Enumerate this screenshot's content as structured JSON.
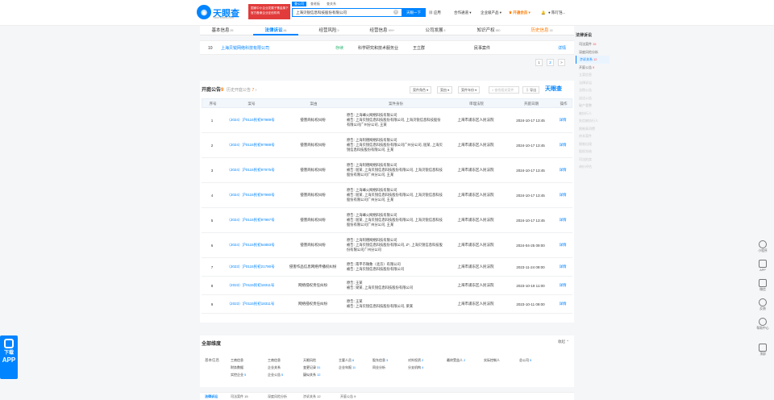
{
  "header": {
    "logo_text": "天眼查",
    "logo_sub": "TianYancha.com",
    "banner_line1": "国家中小企业发展子基金旗下",
    "banner_line2": "官方备案企业征信机构",
    "search_tabs": [
      "查公司",
      "查老板",
      "查关系"
    ],
    "search_value": "上海贝锐信息科技股份有限公司",
    "search_button": "天眼一下",
    "nav": [
      "应用",
      "合作通道",
      "企业级产品",
      "开通会员",
      "我的"
    ],
    "nav_hot": "开通会员",
    "user": "陈叮铛..."
  },
  "tabs": [
    {
      "label": "基本信息",
      "count": "85"
    },
    {
      "label": "法律诉讼",
      "count": "41"
    },
    {
      "label": "经营风险",
      "count": "9"
    },
    {
      "label": "经营信息",
      "count": "999+"
    },
    {
      "label": "公司发展",
      "count": "8"
    },
    {
      "label": "知识产权",
      "count": "580"
    },
    {
      "label": "历史信息",
      "count": "18"
    }
  ],
  "top_row": {
    "index": "10",
    "company": "上海贝锐网络科技有限公司",
    "status": "存续",
    "industry": "科学研究和技术服务业",
    "person": "王立群",
    "type": "民事案件",
    "detail": "详情"
  },
  "pager": [
    "1",
    "2",
    ">"
  ],
  "announcements": {
    "title": "开庭公告",
    "count": "9",
    "history_label": "历史开庭公告",
    "history_count": "7",
    "filters": [
      "案件角色",
      "案由",
      "案件年份"
    ],
    "search_placeholder": "查找相关案件",
    "export_label": "导出",
    "watermark": "天眼查",
    "columns": [
      "序号",
      "案号",
      "案由",
      "案件身份",
      "审理法院",
      "开庭日期",
      "操作"
    ],
    "rows": [
      {
        "no": "1",
        "case_no": "（2024）沪0115民初97989号",
        "cause": "侵害商标权纠纷",
        "parties": [
          "原告: 上海峰火网络科技有限公司",
          "被告: 上海贝锐信息科技股份有限公司, 上海贝锐信息科技股份有限公司广州分公司, 王某"
        ],
        "court": "上海市浦东区人民法院",
        "date": "2024-10-17 13:45",
        "action": "详情"
      },
      {
        "no": "2",
        "case_no": "（2024）沪0115民初97988号",
        "cause": "侵害商标权纠纷",
        "parties": [
          "原告: 上海阿德网络科技有限公司",
          "被告: 上海贝锐信息科技股份有限公司广州分公司, 屈某, 上海贝锐信息科技股份有限公司, 王某"
        ],
        "court": "上海市浦东区人民法院",
        "date": "2024-10-17 13:45",
        "action": "详情"
      },
      {
        "no": "3",
        "case_no": "（2024）沪0115民初97975号",
        "cause": "侵害商标权纠纷",
        "parties": [
          "原告: 上海阿德网络科技有限公司",
          "被告: 屈某, 上海贝锐信息科技股份有限公司, 上海贝锐信息科技股份有限公司广州分公司, 王某"
        ],
        "court": "上海市浦东区人民法院",
        "date": "2024-10-17 13:45",
        "action": "详情"
      },
      {
        "no": "4",
        "case_no": "（2024）沪0115民初97990号",
        "cause": "侵害商标权纠纷",
        "parties": [
          "原告: 上海峰火网络科技有限公司",
          "被告: 屈某, 上海贝锐信息科技股份有限公司, 上海贝锐信息科技股份有限公司广州分公司, 王某"
        ],
        "court": "上海市浦东区人民法院",
        "date": "2024-10-17 13:45",
        "action": "详情"
      },
      {
        "no": "5",
        "case_no": "（2024）沪0115民初97987号",
        "cause": "侵害商标权纠纷",
        "parties": [
          "原告: 上海峰火网络科技有限公司",
          "被告: 屈某, 上海贝锐信息科技股份有限公司, 上海贝锐信息科技股份有限公司广州分公司, 王某"
        ],
        "court": "上海市浦东区人民法院",
        "date": "2024-10-17 13:45",
        "action": "详情"
      },
      {
        "no": "6",
        "case_no": "（2024）沪0115民初54883号",
        "cause": "侵害商标权纠纷",
        "parties": [
          "原告: 上海阿德网络科技有限公司",
          "被告: 上海贝锐信息科技股份有限公司, Z*, 上海贝锐信息科技股份有限公司广州分公司"
        ],
        "court": "上海市浦东区人民法院",
        "date": "2024-04-25 09:00",
        "action": "详情"
      },
      {
        "no": "7",
        "case_no": "（2023）沪0115民初21790号",
        "cause": "侵害作品信息网络传播权纠纷",
        "parties": [
          "原告: 南平市微象（北京）有限公司",
          "被告: 上海贝锐信息科技股份有限公司"
        ],
        "court": "上海市浦东区人民法院",
        "date": "2023-11-24 09:00",
        "action": "详情"
      },
      {
        "no": "8",
        "case_no": "（2023）沪0115民初18311号",
        "cause": "网络侵权责任纠纷",
        "parties": [
          "原告: 王某",
          "被告: 梁某, 上海贝锐信息科技股份有限公司"
        ],
        "court": "上海市浦东区人民法院",
        "date": "2023-10-19 11:00",
        "action": "详情"
      },
      {
        "no": "9",
        "case_no": "（2023）沪0115民初18311号",
        "cause": "网络侵权责任纠纷",
        "parties": [
          "原告: 王某",
          "被告: 上海贝锐信息科技股份有限公司, 梁某"
        ],
        "court": "上海市浦东区人民法院",
        "date": "2023-10-11 09:00",
        "action": "详情"
      }
    ]
  },
  "summary": {
    "title": "全部维度",
    "collapse": "收起",
    "category": "基本信息",
    "items": [
      {
        "label": "工商信息",
        "count": ""
      },
      {
        "label": "工商信息",
        "count": ""
      },
      {
        "label": "天眼风险",
        "count": ""
      },
      {
        "label": "主要人员",
        "count": "6"
      },
      {
        "label": "股东信息",
        "count": "3"
      },
      {
        "label": "对外投资",
        "count": "2"
      },
      {
        "label": "最终受益人",
        "count": "2"
      },
      {
        "label": "实际控制人",
        "count": ""
      },
      {
        "label": "总公司",
        "count": "5"
      },
      {
        "label": "财务数据",
        "count": ""
      },
      {
        "label": "企业关系",
        "count": ""
      },
      {
        "label": "变更记录",
        "count": "31"
      },
      {
        "label": "企业年报",
        "count": "11"
      },
      {
        "label": "同业分析",
        "count": ""
      },
      {
        "label": "分支机构",
        "count": "4"
      },
      {
        "label": "实控企业",
        "count": "5"
      },
      {
        "label": "企业公告",
        "count": "5"
      },
      {
        "label": "疑似关系",
        "count": "12"
      }
    ]
  },
  "bottom_bar": [
    "法律诉讼",
    "司法案件 15",
    "深度风险分析",
    "涉诉关系 12",
    "开庭公告 9"
  ],
  "right_nav": {
    "head": "法律诉讼",
    "items": [
      {
        "label": "司法案件",
        "count": "15"
      },
      {
        "label": "深度风险分析",
        "count": ""
      },
      {
        "label": "涉诉关系",
        "count": "12"
      },
      {
        "label": "开庭公告",
        "count": "9"
      },
      {
        "label": "立案信息",
        "count": ""
      },
      {
        "label": "法律诉讼",
        "count": ""
      },
      {
        "label": "法院公告",
        "count": ""
      },
      {
        "label": "送达公告",
        "count": ""
      },
      {
        "label": "破产重整",
        "count": ""
      },
      {
        "label": "被执行人",
        "count": ""
      },
      {
        "label": "失信被执行人",
        "count": ""
      },
      {
        "label": "限制高消费",
        "count": ""
      },
      {
        "label": "终本案件",
        "count": ""
      },
      {
        "label": "限制出境",
        "count": ""
      },
      {
        "label": "股权冻结",
        "count": ""
      },
      {
        "label": "司法拍卖",
        "count": ""
      },
      {
        "label": "询价评估",
        "count": ""
      }
    ]
  },
  "right_tools": [
    "小程序",
    "APP",
    "微信",
    "反馈",
    "帮助中心",
    "顶部"
  ],
  "app_badge": {
    "line1": "下载",
    "line2": "APP"
  }
}
